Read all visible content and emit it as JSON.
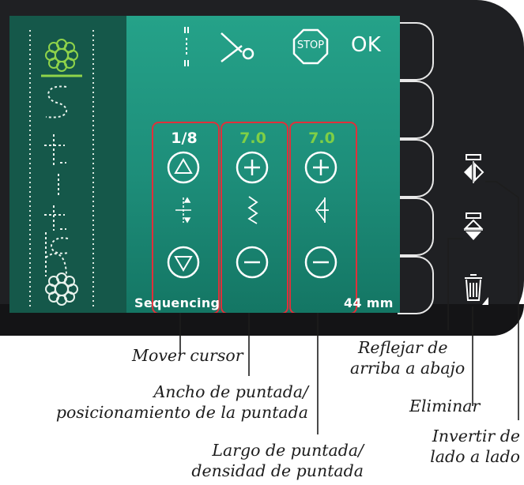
{
  "screen": {
    "top_icons": [
      "needle-position-icon",
      "scissors-cut-icon",
      "stop-icon",
      "ok-button"
    ],
    "ok_label": "OK",
    "stop_label": "STOP",
    "status_left": "Sequencing",
    "status_right": "44 mm",
    "columns": [
      {
        "value": "1/8",
        "value_color": "#ffffff",
        "up_icon": "triangle-up-icon",
        "mid_icon": "move-cursor-icon",
        "down_icon": "triangle-down-icon"
      },
      {
        "value": "7.0",
        "value_color": "#7fcf46",
        "up_icon": "plus-icon",
        "mid_icon": "stitch-width-icon",
        "down_icon": "minus-icon"
      },
      {
        "value": "7.0",
        "value_color": "#7fcf46",
        "up_icon": "plus-icon",
        "mid_icon": "stitch-length-icon",
        "down_icon": "minus-icon"
      }
    ],
    "stitch_preview": {
      "text": "Stitch",
      "accent_color": "#8fd34a"
    }
  },
  "side_icons": [
    "mirror-side-to-side-icon",
    "mirror-end-to-end-icon",
    "delete-trash-icon"
  ],
  "captions": {
    "move_cursor": "Mover cursor",
    "stitch_width_1": "Ancho de puntada/",
    "stitch_width_2": "posicionamiento de la puntada",
    "stitch_length_1": "Largo de puntada/",
    "stitch_length_2": "densidad de puntada",
    "mirror_end_1": "Reflejar de",
    "mirror_end_2": "arriba a abajo",
    "delete": "Eliminar",
    "mirror_side_1": "Invertir de",
    "mirror_side_2": "lado a lado"
  },
  "colors": {
    "highlight_frame": "#e0303a",
    "screen_teal": "#1d8d79",
    "panel": "#1f2023"
  }
}
